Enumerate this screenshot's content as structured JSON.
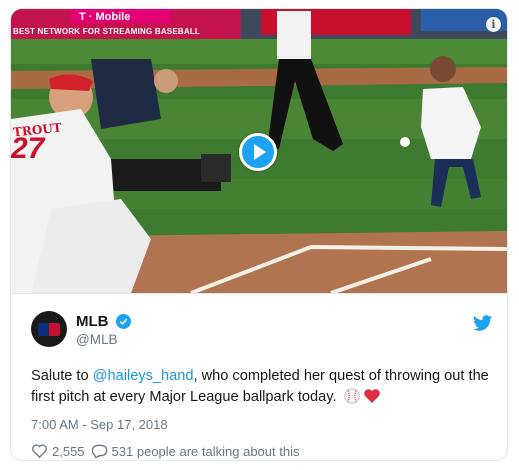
{
  "media": {
    "banner_text": "BEST NETWORK FOR STREAMING BASEBALL",
    "ad_brand": "T · Mobile",
    "jersey_name": "TROUT",
    "jersey_number": "27",
    "info_label": "i"
  },
  "tweet": {
    "display_name": "MLB",
    "handle": "@MLB",
    "text_before": "Salute to ",
    "mention": "@haileys_hand",
    "text_after": ", who completed her quest of throwing out the first pitch at every Major League ballpark today.",
    "timestamp": "7:00 AM - Sep 17, 2018",
    "likes": "2,555",
    "talking": "531 people are talking about this"
  },
  "colors": {
    "accent": "#1da1f2",
    "mention": "#1b95e0",
    "secondary_text": "#657786",
    "heart": "#e0245e"
  },
  "icons": [
    "info-icon",
    "play-icon",
    "verified-icon",
    "twitter-bird-icon",
    "baseball-emoji",
    "red-heart-emoji",
    "heart-icon",
    "reply-bubble-icon"
  ]
}
